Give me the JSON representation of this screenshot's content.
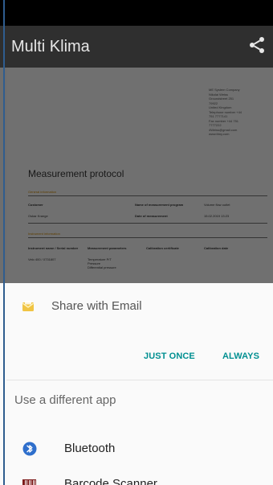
{
  "app": {
    "title": "Multi Klima"
  },
  "document_preview": {
    "company_lines": "ME System Company\nNikolai Weiss\nGroundstreet 251\n79922\nUnited Kingdom\nTelephone number +44\n751 7777141\nFax number +44 751\n7777222\n4Weiss@gmail.com\nwww.ttmy.com",
    "title": "Measurement protocol",
    "sections": {
      "general": "General information",
      "instrument": "Instrument information"
    },
    "labels": {
      "customer": "Customer",
      "customer_value": "Oskar Krange",
      "measurement_program": "Name of measurement program",
      "program_value": "Volume flow outlet",
      "measurement_date": "Date of measurement",
      "date_value": "15.02.2019 13:23",
      "instrument_name": "Instrument name / Serial number",
      "instrument_value": "Velo 400 / 0731807",
      "parameters": "Measurement parameters",
      "parameters_value": "Temperature P/T\nPressure\nDifferential pressure",
      "calibration_certificate": "Calibration certificate",
      "calibration_date": "Calibration date"
    }
  },
  "share_sheet": {
    "primary": {
      "label": "Share with Email",
      "actions": {
        "just_once": "JUST ONCE",
        "always": "ALWAYS"
      }
    },
    "alternate_title": "Use a different app",
    "apps": [
      {
        "label": "Bluetooth",
        "icon": "bluetooth-icon"
      },
      {
        "label": "Barcode Scanner",
        "icon": "barcode-icon"
      }
    ]
  },
  "colors": {
    "accent": "#008f91",
    "document_section": "#d58d00",
    "bluetooth": "#2f6fcc"
  }
}
